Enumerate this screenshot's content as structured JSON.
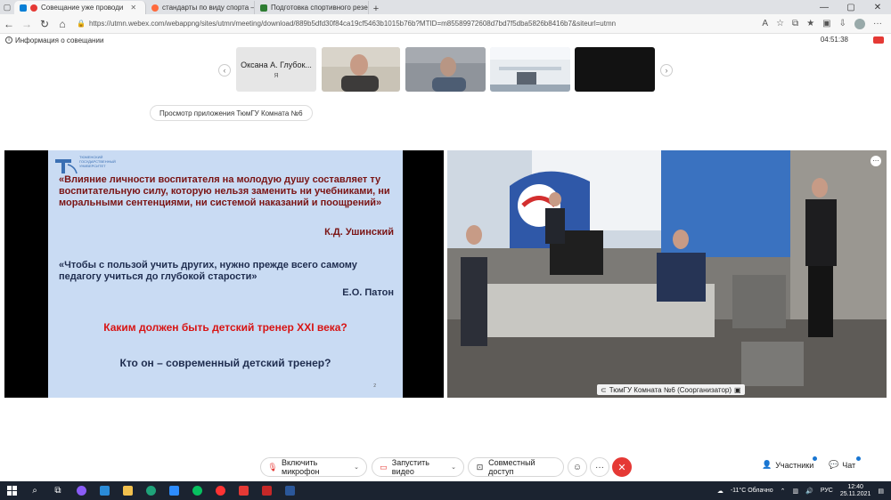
{
  "browser": {
    "tabs": [
      {
        "label": "Совещание уже проводи",
        "active": true,
        "color": "#0a7fd6"
      },
      {
        "label": "стандарты по виду спорта — Я",
        "active": false,
        "color": "#ff6a3d"
      },
      {
        "label": "Подготовка спортивного резе",
        "active": false,
        "color": "#2e7d32"
      }
    ],
    "url": "https://utmn.webex.com/webappng/sites/utmn/meeting/download/889b5dfd30f84ca19cf5463b1015b76b?MTID=m85589972608d7bd7f5dba5826b8416b7&siteurl=utmn"
  },
  "meeting": {
    "info_label": "Информация о совещании",
    "timer": "04:51:38",
    "participants": [
      {
        "name": "Оксана А. Глубок...",
        "sub": "Я",
        "type": "name"
      },
      {
        "type": "video-man-1"
      },
      {
        "type": "video-man-2"
      },
      {
        "type": "video-room"
      },
      {
        "type": "video-black"
      }
    ],
    "app_view_label": "Просмотр приложения ТюмГУ Комната №6",
    "video_label": "ТюмГУ Комната №6 (Соорганизатор)"
  },
  "slide": {
    "logo_text": "ТЮМЕНСКИЙ ГОСУДАРСТВЕННЫЙ УНИВЕРСИТЕТ",
    "quote1": "«Влияние личности воспитателя на молодую душу составляет  ту воспитательную силу, которую нельзя заменить ни учебниками, ни моральными сентенциями, ни системой наказаний и поощрений»",
    "author1": "К.Д. Ушинский",
    "quote2": "«Чтобы с пользой учить других, нужно прежде всего самому педагогу учиться до глубокой старости»",
    "author2": "Е.О. Патон",
    "question1": "Каким должен быть детский тренер XXI века?",
    "question2": "Кто он – современный детский тренер?",
    "page": "2"
  },
  "controls": {
    "mic": "Включить микрофон",
    "video": "Запустить видео",
    "share": "Совместный доступ",
    "participants": "Участники",
    "chat": "Чат"
  },
  "taskbar": {
    "weather": "-11°C  Облачно",
    "lang": "РУС",
    "time": "12:40",
    "date": "25.11.2021"
  }
}
